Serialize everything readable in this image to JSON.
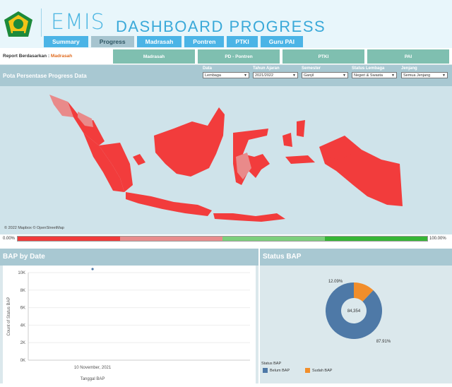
{
  "header": {
    "brand": "EMIS",
    "title": "DASHBOARD PROGRESS"
  },
  "tabs": [
    {
      "label": "Summary",
      "active": false
    },
    {
      "label": "Progress",
      "active": true
    },
    {
      "label": "Madrasah",
      "active": false
    },
    {
      "label": "Pontren",
      "active": false
    },
    {
      "label": "PTKI",
      "active": false
    },
    {
      "label": "Guru PAI",
      "active": false
    }
  ],
  "report": {
    "label": "Report Berdasarkan :",
    "value": "Madrasah",
    "buttons": [
      "Madrasah",
      "PD - Pontren",
      "PTKI",
      "PAI"
    ]
  },
  "map": {
    "title": "Pota Persentase Progress Data",
    "credit": "© 2022 Mapbox  © OpenStreetMap",
    "filters": [
      {
        "label": "Data",
        "value": "Lembaga"
      },
      {
        "label": "Tahun Ajaran",
        "value": "2021/2022"
      },
      {
        "label": "Semester",
        "value": "Ganjil"
      },
      {
        "label": "Status Lembaga",
        "value": "Negeri & Swasta"
      },
      {
        "label": "Jenjang",
        "value": "Semua Jenjang"
      }
    ],
    "scale_min": "0.00%",
    "scale_max": "100.00%",
    "scale_colors": [
      "#f03a3a",
      "#e88c8c",
      "#7ccf7c",
      "#36b536"
    ],
    "region_colors": {
      "low": "#f23c3c",
      "mid": "#e98a8a"
    }
  },
  "bap_by_date": {
    "title": "BAP by Date",
    "chart_data": {
      "type": "scatter",
      "x": [
        "10 November, 2021"
      ],
      "y": [
        10000
      ],
      "xlabel": "Tanggal BAP",
      "ylabel": "Count of Status BAP",
      "yticks": [
        "0K",
        "2K",
        "4K",
        "6K",
        "8K",
        "10K"
      ],
      "ylim": [
        0,
        10000
      ]
    },
    "point_color": "#4e79a7"
  },
  "status_bap": {
    "title": "Status BAP",
    "chart_data": {
      "type": "pie",
      "categories": [
        "Belum BAP",
        "Sudah BAP"
      ],
      "values": [
        87.91,
        12.09
      ],
      "labels": [
        "87.91%",
        "12.09%"
      ],
      "center_label": "84,354",
      "legend_title": "Status BAP"
    },
    "colors": [
      "#4e79a7",
      "#f28e2b"
    ]
  }
}
